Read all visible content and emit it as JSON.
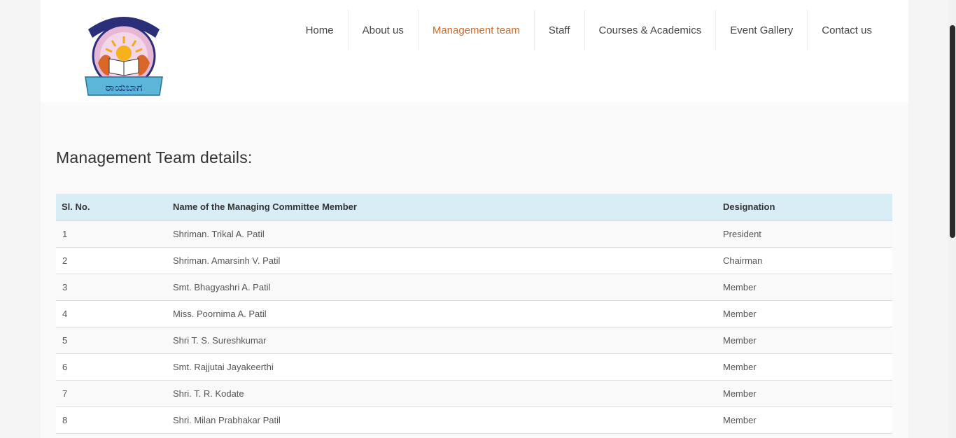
{
  "header": {
    "logo_text": "ರಾಯಬಾಗ",
    "nav": [
      {
        "label": "Home",
        "active": false
      },
      {
        "label": "About us",
        "active": false
      },
      {
        "label": "Management team",
        "active": true
      },
      {
        "label": "Staff",
        "active": false
      },
      {
        "label": "Courses & Academics",
        "active": false
      },
      {
        "label": "Event Gallery",
        "active": false
      },
      {
        "label": "Contact us",
        "active": false
      }
    ]
  },
  "main": {
    "title": "Management Team details:",
    "table": {
      "headers": [
        "Sl. No.",
        "Name of the Managing Committee Member",
        "Designation"
      ],
      "rows": [
        [
          "1",
          "Shriman. Trikal A. Patil",
          "President"
        ],
        [
          "2",
          "Shriman. Amarsinh V. Patil",
          "Chairman"
        ],
        [
          "3",
          "Smt. Bhagyashri A. Patil",
          "Member"
        ],
        [
          "4",
          "Miss. Poornima A. Patil",
          "Member"
        ],
        [
          "5",
          "Shri T. S. Sureshkumar",
          "Member"
        ],
        [
          "6",
          "Smt. Rajjutai Jayakeerthi",
          "Member"
        ],
        [
          "7",
          "Shri. T. R. Kodate",
          "Member"
        ],
        [
          "8",
          "Shri. Milan Prabhakar Patil",
          "Member"
        ]
      ]
    }
  },
  "colors": {
    "accent": "#c96d2e",
    "table_header_bg": "#d9edf7",
    "page_bg": "#fafafa"
  }
}
